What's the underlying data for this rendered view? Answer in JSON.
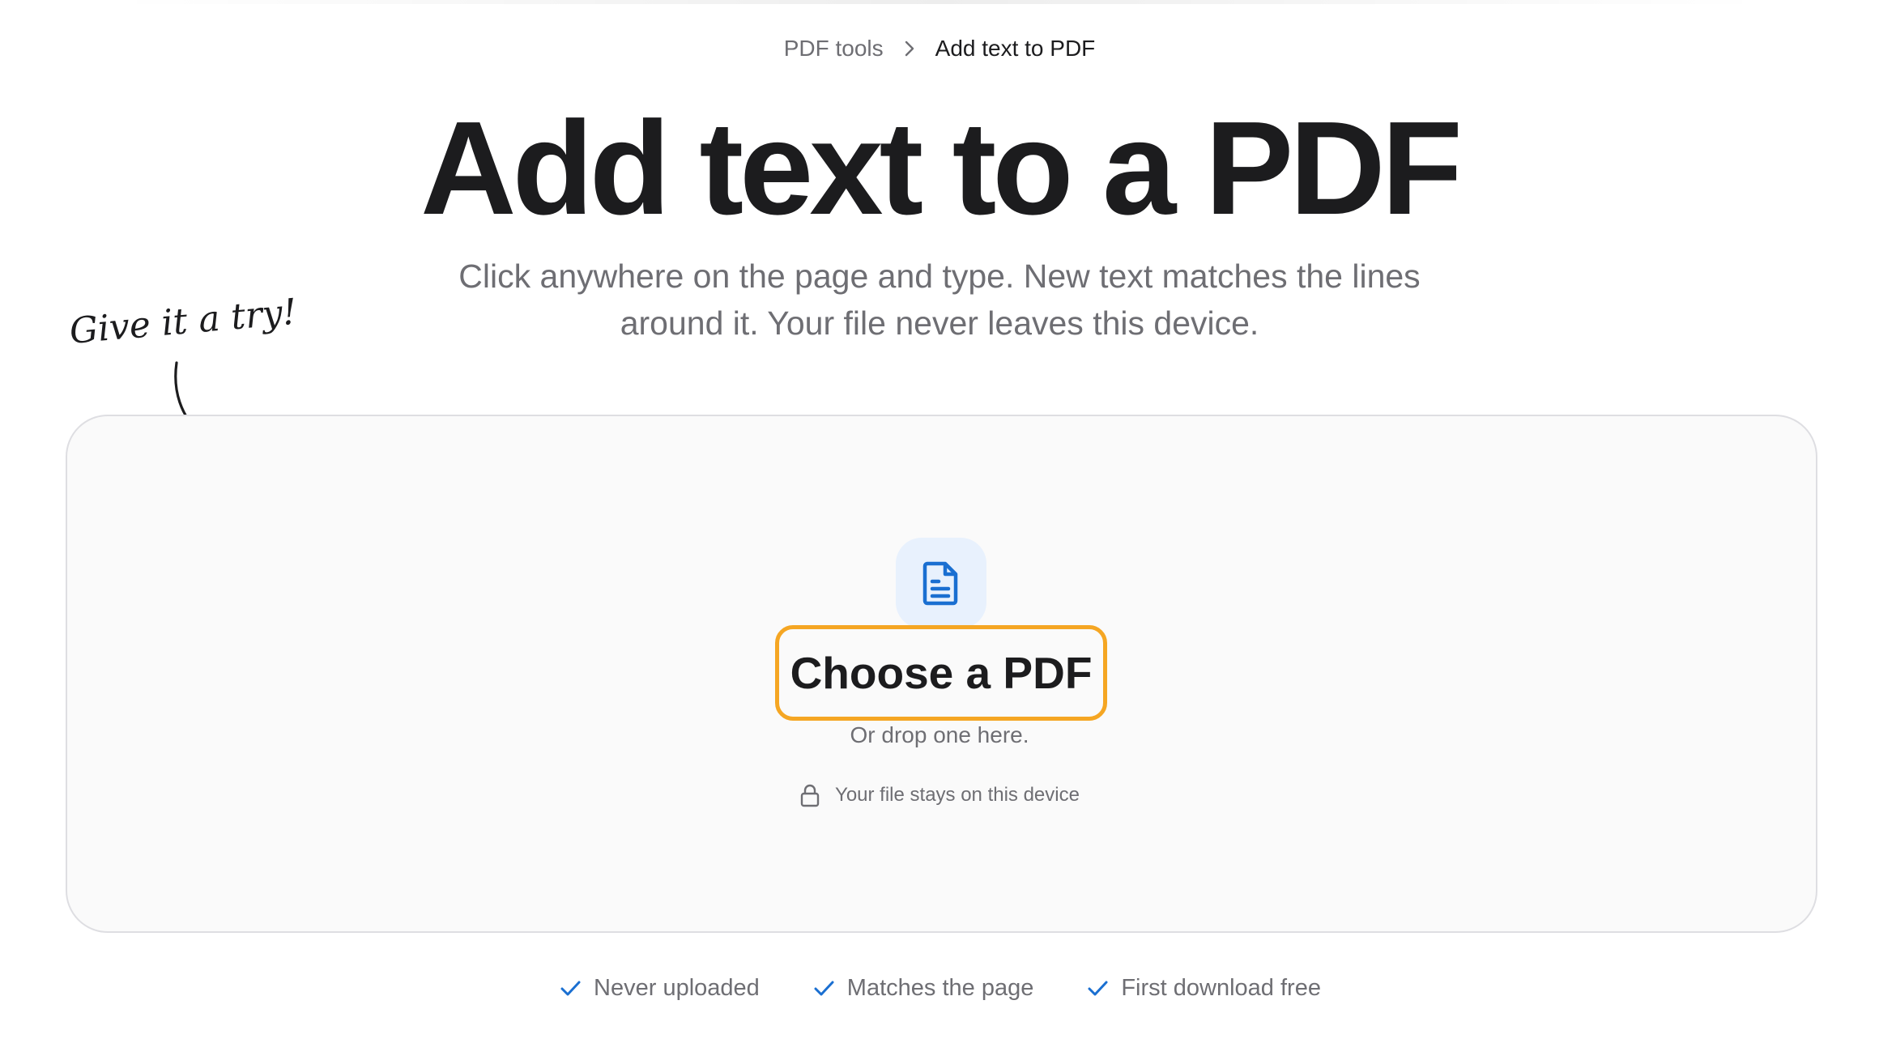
{
  "breadcrumb": {
    "parent": "PDF tools",
    "current": "Add text to PDF"
  },
  "hero": {
    "title": "Add text to a PDF",
    "subtitle_line1": "Click anywhere on the page and type. New text matches the lines",
    "subtitle_line2": "around it. Your file never leaves this device."
  },
  "hint": {
    "text": "Give it a try!"
  },
  "dropzone": {
    "icon": "file-text-icon",
    "button_label": "Choose a PDF",
    "drop_text": "Or drop one here.",
    "privacy_icon": "lock-icon",
    "privacy_text": "Your file stays on this device"
  },
  "features": [
    {
      "icon": "check-icon",
      "label": "Never uploaded"
    },
    {
      "icon": "check-icon",
      "label": "Matches the page"
    },
    {
      "icon": "check-icon",
      "label": "First download free"
    }
  ],
  "colors": {
    "accent_blue": "#1a6fd1",
    "button_outline": "#f5a623",
    "icon_badge_bg": "#e8f1fd",
    "text_primary": "#1c1c1e",
    "text_secondary": "#6e6e73"
  }
}
